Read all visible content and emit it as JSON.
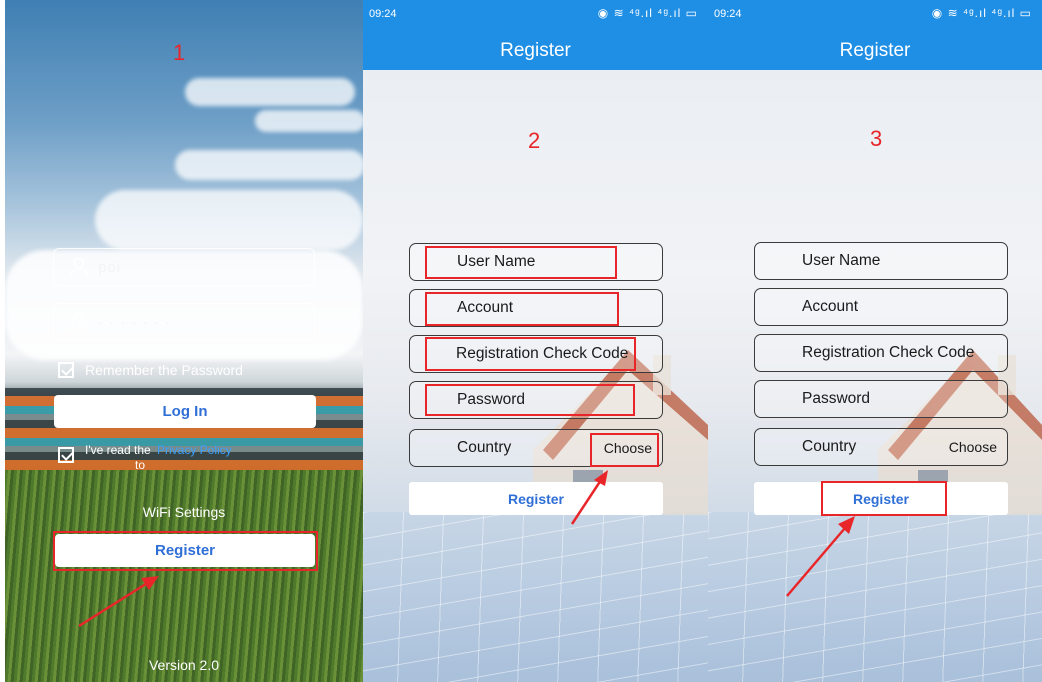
{
  "panel1": {
    "step": "1",
    "username_value": "poi",
    "password_value": "· · · · · · ·",
    "remember_label": "Remember the Password",
    "login_label": "Log In",
    "agree_text_1": "I've read the",
    "agree_link": "Privacy Policy",
    "agree_text_2": "to",
    "wifi_label": "WiFi Settings",
    "register_label": "Register",
    "version": "Version 2.0"
  },
  "panel2": {
    "status_time": "09:24",
    "status_icons": "◉ ≋ ⁴ᵍ.ıl ⁴ᵍ.ıl ▭",
    "title": "Register",
    "step": "2",
    "fields": [
      "User Name",
      "Account",
      "Registration Check Code",
      "Password"
    ],
    "country_label": "Country",
    "choose_label": "Choose",
    "register_label": "Register"
  },
  "panel3": {
    "status_time": "09:24",
    "status_icons": "◉ ≋ ⁴ᵍ.ıl ⁴ᵍ.ıl ▭",
    "title": "Register",
    "step": "3",
    "fields": [
      "User Name",
      "Account",
      "Registration Check Code",
      "Password"
    ],
    "country_label": "Country",
    "choose_label": "Choose",
    "register_label": "Register"
  },
  "colors": {
    "accent": "#1f8fe6",
    "highlight": "#e8262a",
    "button_text": "#2f6fd6"
  },
  "icons": [
    "user-icon",
    "lock-icon",
    "checkbox-icon",
    "arrow-icon"
  ]
}
